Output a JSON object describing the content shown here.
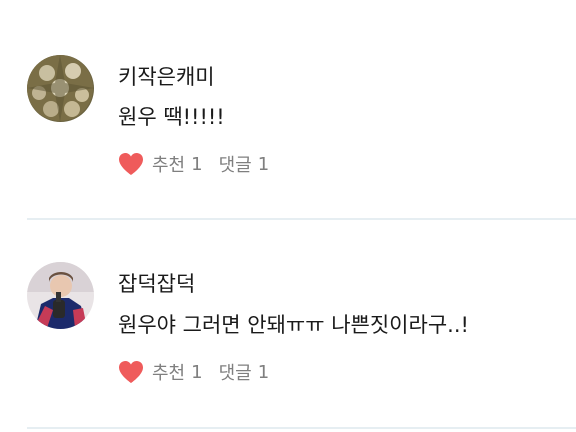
{
  "comments": [
    {
      "author": "키작은캐미",
      "text": "원우 땍!!!!!",
      "like_label": "추천",
      "like_count": "1",
      "reply_label": "댓글",
      "reply_count": "1"
    },
    {
      "author": "잡덕잡덕",
      "text": "원우야 그러면 안돼ㅠㅠ 나쁜짓이라구..!",
      "like_label": "추천",
      "like_count": "1",
      "reply_label": "댓글",
      "reply_count": "1"
    }
  ],
  "colors": {
    "heart": "#ef5b5b",
    "meta_text": "#7f7f7f",
    "divider": "#e6eef2"
  },
  "icons": [
    "heart-icon"
  ]
}
